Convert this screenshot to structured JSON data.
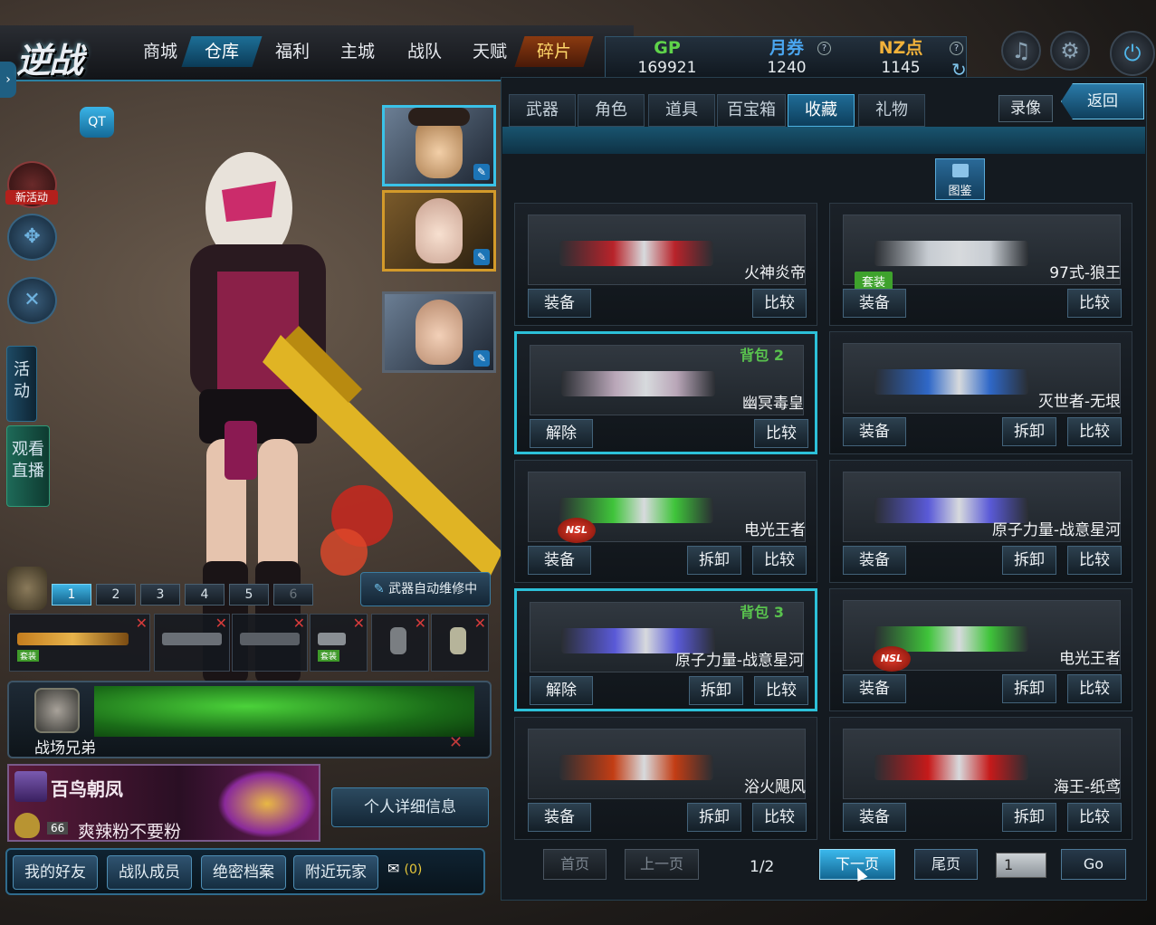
{
  "header": {
    "logo": "逆战",
    "nav": [
      "商城",
      "仓库",
      "福利",
      "主城",
      "战队",
      "天赋",
      "碎片"
    ],
    "active_nav": "仓库"
  },
  "currency": {
    "gp_label": "GP",
    "gp_value": "169921",
    "month_label": "月券",
    "month_value": "1240",
    "nz_label": "NZ点",
    "nz_value": "1145"
  },
  "left": {
    "new_event": "新活动",
    "activity_tab": "活动",
    "watch_tab": "观看直播",
    "repair_label": "武器自动维修中",
    "slot_numbers": [
      "1",
      "2",
      "3",
      "4",
      "5",
      "6"
    ],
    "weapon_tags": [
      "套装",
      "套装"
    ],
    "team_name": "战场兄弟",
    "profile_title": "百鸟朝凤",
    "player_level": "66",
    "player_name": "爽辣粉不要粉",
    "profile_button": "个人详细信息",
    "friends": [
      "我的好友",
      "战队成员",
      "绝密档案",
      "附近玩家"
    ],
    "mail_count": "(0)"
  },
  "panel": {
    "tabs": [
      "武器",
      "角色",
      "道具",
      "百宝箱",
      "收藏",
      "礼物"
    ],
    "active_tab": "收藏",
    "record": "录像",
    "back": "返回",
    "tujian": "图鉴",
    "cards": [
      {
        "name": "火神炎帝",
        "left_btn": "装备",
        "mid_btn": "",
        "right_btn": "比较",
        "bag": "",
        "suit": "",
        "nsl": false,
        "gun_color": "#b8232a"
      },
      {
        "name": "97式-狼王",
        "left_btn": "装备",
        "mid_btn": "",
        "right_btn": "比较",
        "bag": "",
        "suit": "套装",
        "nsl": false,
        "gun_color": "#c7ccd2"
      },
      {
        "name": "幽冥毒皇",
        "left_btn": "解除",
        "mid_btn": "",
        "right_btn": "比较",
        "bag": "背包 2",
        "suit": "",
        "nsl": false,
        "gun_color": "#b9a6b8"
      },
      {
        "name": "灭世者-无垠",
        "left_btn": "装备",
        "mid_btn": "拆卸",
        "right_btn": "比较",
        "bag": "",
        "suit": "",
        "nsl": false,
        "gun_color": "#2f68c8"
      },
      {
        "name": "电光王者",
        "left_btn": "装备",
        "mid_btn": "拆卸",
        "right_btn": "比较",
        "bag": "",
        "suit": "",
        "nsl": true,
        "gun_color": "#3fc43a"
      },
      {
        "name": "原子力量-战意星河",
        "left_btn": "装备",
        "mid_btn": "拆卸",
        "right_btn": "比较",
        "bag": "",
        "suit": "",
        "nsl": false,
        "gun_color": "#5a5ad8"
      },
      {
        "name": "原子力量-战意星河",
        "left_btn": "解除",
        "mid_btn": "拆卸",
        "right_btn": "比较",
        "bag": "背包 3",
        "suit": "",
        "nsl": false,
        "gun_color": "#5a5ad8"
      },
      {
        "name": "电光王者",
        "left_btn": "装备",
        "mid_btn": "拆卸",
        "right_btn": "比较",
        "bag": "",
        "suit": "",
        "nsl": true,
        "gun_color": "#3fc43a"
      },
      {
        "name": "浴火飓风",
        "left_btn": "装备",
        "mid_btn": "拆卸",
        "right_btn": "比较",
        "bag": "",
        "suit": "",
        "nsl": false,
        "gun_color": "#c33d14"
      },
      {
        "name": "海王-纸鸢",
        "left_btn": "装备",
        "mid_btn": "拆卸",
        "right_btn": "比较",
        "bag": "",
        "suit": "",
        "nsl": false,
        "gun_color": "#c61a1a"
      }
    ],
    "pager": {
      "first": "首页",
      "prev": "上一页",
      "info": "1/2",
      "next": "下一页",
      "last": "尾页",
      "input_value": "1",
      "go": "Go"
    }
  },
  "colors": {
    "accent": "#2cc0d8",
    "gp": "#5fd34a",
    "month": "#4aa6f0",
    "nz": "#f2b23a",
    "bag_green": "#59c24e"
  }
}
